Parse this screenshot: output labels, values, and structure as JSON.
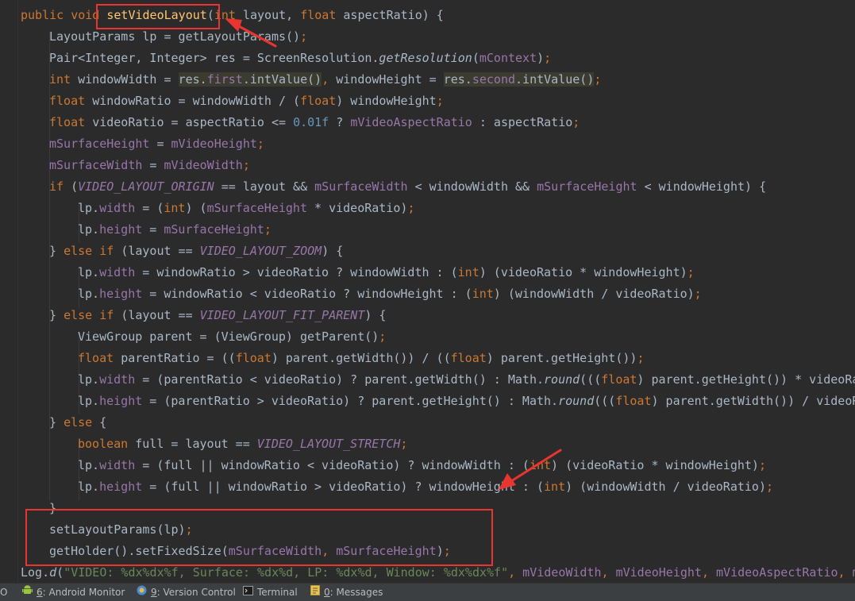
{
  "editor": {
    "lines": [
      {
        "indent": 0,
        "tokens": [
          [
            "kw",
            "public "
          ],
          [
            "kw",
            "void "
          ],
          [
            "fn",
            "setVideoLayout"
          ],
          [
            "plain",
            "("
          ],
          [
            "kw",
            "int "
          ],
          [
            "plain",
            "layout, "
          ],
          [
            "kw",
            "float "
          ],
          [
            "plain",
            "aspectRatio) {"
          ]
        ]
      },
      {
        "indent": 1,
        "tokens": [
          [
            "plain",
            "LayoutParams lp = getLayoutParams()"
          ],
          [
            "kw",
            ";"
          ]
        ]
      },
      {
        "indent": 1,
        "tokens": [
          [
            "plain",
            "Pair<Integer, Integer> res = ScreenResolution."
          ],
          [
            "mth",
            "getResolution"
          ],
          [
            "plain",
            "("
          ],
          [
            "fld",
            "mContext"
          ],
          [
            "plain",
            ")"
          ],
          [
            "kw",
            ";"
          ]
        ]
      },
      {
        "indent": 1,
        "tokens": [
          [
            "kw",
            "int "
          ],
          [
            "plain",
            "windowWidth = "
          ],
          [
            "hl",
            "res."
          ],
          [
            "hlfld",
            "first"
          ],
          [
            "hl",
            ".intValue()"
          ],
          [
            "kw",
            ", "
          ],
          [
            "plain",
            "windowHeight = "
          ],
          [
            "hl",
            "res."
          ],
          [
            "hlfld",
            "second"
          ],
          [
            "hl",
            ".intValue()"
          ],
          [
            "kw",
            ";"
          ]
        ]
      },
      {
        "indent": 1,
        "tokens": [
          [
            "kw",
            "float "
          ],
          [
            "plain",
            "windowRatio = windowWidth / ("
          ],
          [
            "kw",
            "float"
          ],
          [
            "plain",
            ") windowHeight"
          ],
          [
            "kw",
            ";"
          ]
        ]
      },
      {
        "indent": 1,
        "tokens": [
          [
            "kw",
            "float "
          ],
          [
            "plain",
            "videoRatio = aspectRatio <= "
          ],
          [
            "num",
            "0.01f"
          ],
          [
            "plain",
            " ? "
          ],
          [
            "fld",
            "mVideoAspectRatio"
          ],
          [
            "plain",
            " : aspectRatio"
          ],
          [
            "kw",
            ";"
          ]
        ]
      },
      {
        "indent": 1,
        "tokens": [
          [
            "fld",
            "mSurfaceHeight"
          ],
          [
            "plain",
            " = "
          ],
          [
            "fld",
            "mVideoHeight"
          ],
          [
            "kw",
            ";"
          ]
        ]
      },
      {
        "indent": 1,
        "tokens": [
          [
            "fld",
            "mSurfaceWidth"
          ],
          [
            "plain",
            " = "
          ],
          [
            "fld",
            "mVideoWidth"
          ],
          [
            "kw",
            ";"
          ]
        ]
      },
      {
        "indent": 1,
        "tokens": [
          [
            "kw",
            "if "
          ],
          [
            "plain",
            "("
          ],
          [
            "cst",
            "VIDEO_LAYOUT_ORIGIN"
          ],
          [
            "plain",
            " == layout && "
          ],
          [
            "fld",
            "mSurfaceWidth"
          ],
          [
            "plain",
            " < windowWidth && "
          ],
          [
            "fld",
            "mSurfaceHeight"
          ],
          [
            "plain",
            " < windowHeight) {"
          ]
        ]
      },
      {
        "indent": 2,
        "tokens": [
          [
            "plain",
            "lp."
          ],
          [
            "fld",
            "width"
          ],
          [
            "plain",
            " = ("
          ],
          [
            "kw",
            "int"
          ],
          [
            "plain",
            ") ("
          ],
          [
            "fld",
            "mSurfaceHeight"
          ],
          [
            "plain",
            " * videoRatio)"
          ],
          [
            "kw",
            ";"
          ]
        ]
      },
      {
        "indent": 2,
        "tokens": [
          [
            "plain",
            "lp."
          ],
          [
            "fld",
            "height"
          ],
          [
            "plain",
            " = "
          ],
          [
            "fld",
            "mSurfaceHeight"
          ],
          [
            "kw",
            ";"
          ]
        ]
      },
      {
        "indent": 1,
        "tokens": [
          [
            "plain",
            "} "
          ],
          [
            "kw",
            "else if "
          ],
          [
            "plain",
            "(layout == "
          ],
          [
            "cst",
            "VIDEO_LAYOUT_ZOOM"
          ],
          [
            "plain",
            ") {"
          ]
        ]
      },
      {
        "indent": 2,
        "tokens": [
          [
            "plain",
            "lp."
          ],
          [
            "fld",
            "width"
          ],
          [
            "plain",
            " = windowRatio > videoRatio ? windowWidth : ("
          ],
          [
            "kw",
            "int"
          ],
          [
            "plain",
            ") (videoRatio * windowHeight)"
          ],
          [
            "kw",
            ";"
          ]
        ]
      },
      {
        "indent": 2,
        "tokens": [
          [
            "plain",
            "lp."
          ],
          [
            "fld",
            "height"
          ],
          [
            "plain",
            " = windowRatio < videoRatio ? windowHeight : ("
          ],
          [
            "kw",
            "int"
          ],
          [
            "plain",
            ") (windowWidth / videoRatio)"
          ],
          [
            "kw",
            ";"
          ]
        ]
      },
      {
        "indent": 1,
        "tokens": [
          [
            "plain",
            "} "
          ],
          [
            "kw",
            "else if "
          ],
          [
            "plain",
            "(layout == "
          ],
          [
            "cst",
            "VIDEO_LAYOUT_FIT_PARENT"
          ],
          [
            "plain",
            ") {"
          ]
        ]
      },
      {
        "indent": 2,
        "tokens": [
          [
            "plain",
            "ViewGroup parent = (ViewGroup) getParent()"
          ],
          [
            "kw",
            ";"
          ]
        ]
      },
      {
        "indent": 2,
        "tokens": [
          [
            "kw",
            "float "
          ],
          [
            "plain",
            "parentRatio = (("
          ],
          [
            "kw",
            "float"
          ],
          [
            "plain",
            ") parent.getWidth()) / (("
          ],
          [
            "kw",
            "float"
          ],
          [
            "plain",
            ") parent.getHeight())"
          ],
          [
            "kw",
            ";"
          ]
        ]
      },
      {
        "indent": 2,
        "tokens": [
          [
            "plain",
            "lp."
          ],
          [
            "fld",
            "width"
          ],
          [
            "plain",
            " = (parentRatio < videoRatio) ? parent.getWidth() : Math."
          ],
          [
            "mth",
            "round"
          ],
          [
            "plain",
            "((("
          ],
          [
            "kw",
            "float"
          ],
          [
            "plain",
            ") parent.getHeight()) * videoRa"
          ]
        ]
      },
      {
        "indent": 2,
        "tokens": [
          [
            "plain",
            "lp."
          ],
          [
            "fld",
            "height"
          ],
          [
            "plain",
            " = (parentRatio > videoRatio) ? parent.getHeight() : Math."
          ],
          [
            "mth",
            "round"
          ],
          [
            "plain",
            "((("
          ],
          [
            "kw",
            "float"
          ],
          [
            "plain",
            ") parent.getWidth()) / videoR"
          ]
        ]
      },
      {
        "indent": 1,
        "tokens": [
          [
            "plain",
            "} "
          ],
          [
            "kw",
            "else "
          ],
          [
            "plain",
            "{"
          ]
        ]
      },
      {
        "indent": 2,
        "tokens": [
          [
            "kw",
            "boolean "
          ],
          [
            "plain",
            "full = layout == "
          ],
          [
            "cst",
            "VIDEO_LAYOUT_STRETCH"
          ],
          [
            "kw",
            ";"
          ]
        ]
      },
      {
        "indent": 2,
        "tokens": [
          [
            "plain",
            "lp."
          ],
          [
            "fld",
            "width"
          ],
          [
            "plain",
            " = (full || windowRatio < videoRatio) ? windowWidth : ("
          ],
          [
            "kw",
            "int"
          ],
          [
            "plain",
            ") (videoRatio * windowHeight)"
          ],
          [
            "kw",
            ";"
          ]
        ]
      },
      {
        "indent": 2,
        "tokens": [
          [
            "plain",
            "lp."
          ],
          [
            "fld",
            "height"
          ],
          [
            "plain",
            " = (full || windowRatio > videoRatio) ? windowHeight : ("
          ],
          [
            "kw",
            "int"
          ],
          [
            "plain",
            ") (windowWidth / videoRatio)"
          ],
          [
            "kw",
            ";"
          ]
        ]
      },
      {
        "indent": 1,
        "tokens": [
          [
            "plain",
            "}"
          ]
        ]
      },
      {
        "indent": 1,
        "tokens": [
          [
            "plain",
            "setLayoutParams(lp)"
          ],
          [
            "kw",
            ";"
          ]
        ]
      },
      {
        "indent": 1,
        "tokens": [
          [
            "plain",
            "getHolder().setFixedSize("
          ],
          [
            "fld",
            "mSurfaceWidth"
          ],
          [
            "kw",
            ", "
          ],
          [
            "fld",
            "mSurfaceHeight"
          ],
          [
            "plain",
            ")"
          ],
          [
            "kw",
            ";"
          ]
        ]
      },
      {
        "indent": 0,
        "tokens": [
          [
            "plain",
            "Log."
          ],
          [
            "mth",
            "d"
          ],
          [
            "plain",
            "("
          ],
          [
            "str",
            "\"VIDEO: %dx%dx%f, Surface: %dx%d, LP: %dx%d, Window: %dx%dx%f\""
          ],
          [
            "kw",
            ", "
          ],
          [
            "fld",
            "mVideoWidth"
          ],
          [
            "kw",
            ", "
          ],
          [
            "fld",
            "mVideoHeight"
          ],
          [
            "kw",
            ", "
          ],
          [
            "fld",
            "mVideoAspectRatio"
          ],
          [
            "kw",
            ", "
          ],
          [
            "fld",
            "m"
          ]
        ]
      }
    ]
  },
  "colors": {
    "background": "#2b2b2b",
    "keyword": "#cc7832",
    "method_decl": "#ffc66d",
    "field": "#9876aa",
    "number": "#6897bb",
    "string": "#6a8759",
    "plain": "#a9b7c6",
    "annotation": "#e8352f",
    "statusbar": "#3c3f41"
  },
  "annotations": [
    {
      "type": "box",
      "target": "setVideoLayout"
    },
    {
      "type": "arrow",
      "target": "setVideoLayout"
    },
    {
      "type": "arrow",
      "target": "windowHeight"
    },
    {
      "type": "box",
      "target": "setLayoutParams / getHolder().setFixedSize"
    }
  ],
  "statusbar": {
    "left_fragment": "O",
    "tools": [
      {
        "num": "6",
        "label": ": Android Monitor",
        "icon": "android-icon"
      },
      {
        "num": "9",
        "label": ": Version Control",
        "icon": "version-control-icon"
      },
      {
        "num": "",
        "label": "Terminal",
        "icon": "terminal-icon"
      },
      {
        "num": "0",
        "label": ": Messages",
        "icon": "messages-icon"
      }
    ]
  }
}
